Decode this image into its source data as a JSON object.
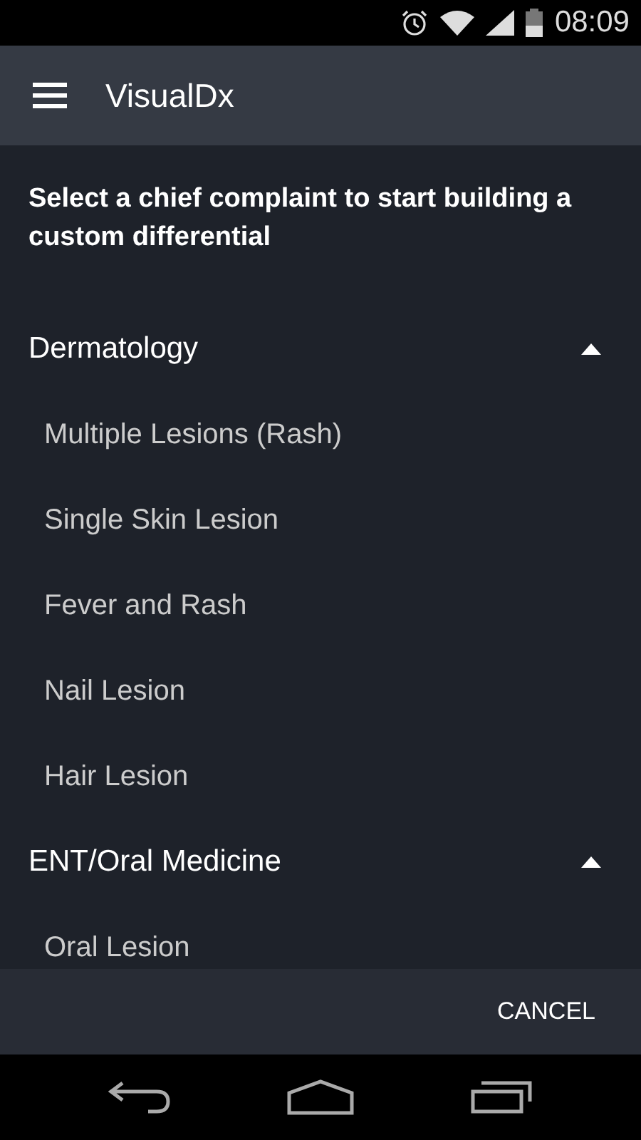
{
  "status_bar": {
    "time": "08:09"
  },
  "toolbar": {
    "title": "VisualDx"
  },
  "prompt": "Select a chief complaint to start building a custom differential",
  "groups": [
    {
      "title": "Dermatology",
      "expanded": true,
      "items": [
        "Multiple Lesions (Rash)",
        "Single Skin Lesion",
        "Fever and Rash",
        "Nail Lesion",
        "Hair Lesion"
      ]
    },
    {
      "title": "ENT/Oral Medicine",
      "expanded": true,
      "items": [
        "Oral Lesion"
      ]
    }
  ],
  "footer": {
    "button": "CANCEL"
  }
}
